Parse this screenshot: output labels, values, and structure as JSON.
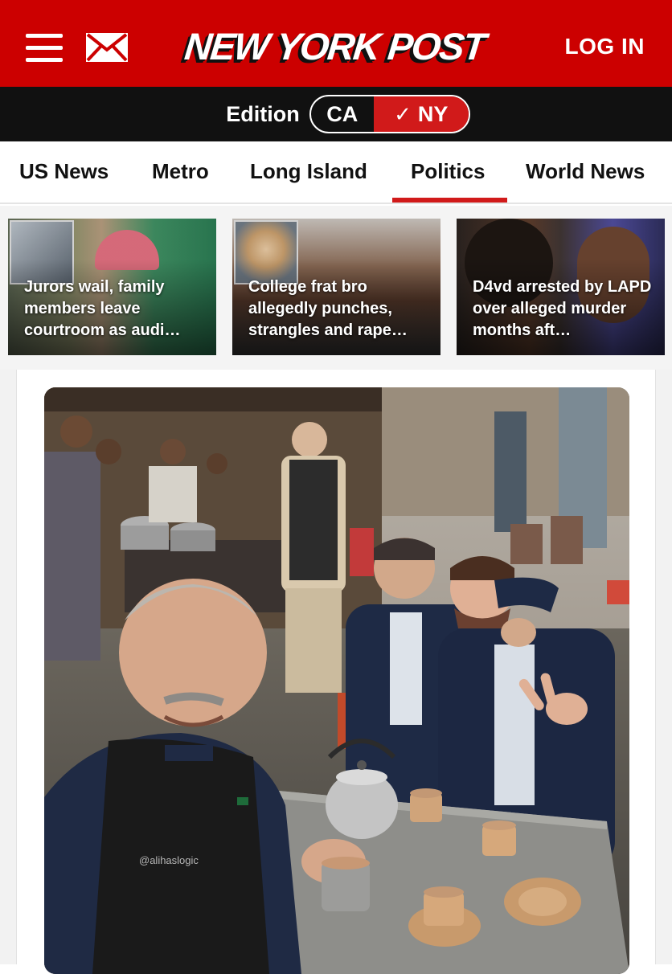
{
  "header": {
    "brand": "NEW YORK POST",
    "login_label": "LOG IN",
    "menu_icon": "hamburger-menu-icon",
    "mail_icon": "mail-envelope-icon",
    "colors": {
      "brand_red": "#cc0000",
      "edition_bar": "#111111"
    }
  },
  "edition": {
    "label": "Edition",
    "options": [
      "CA",
      "NY"
    ],
    "selected": "NY",
    "check_icon": "checkmark-icon"
  },
  "nav": {
    "items": [
      "US News",
      "Metro",
      "Long Island",
      "Politics",
      "World News"
    ],
    "active": "Politics"
  },
  "stories": [
    {
      "title": "Jurors wail, family members leave courtroom as audi…"
    },
    {
      "title": "College frat bro allegedly punches, strangles and rape…"
    },
    {
      "title": "D4vd arrested by LAPD over alleged murder months aft…"
    }
  ],
  "photo": {
    "watermark": "@alihaslogic"
  }
}
